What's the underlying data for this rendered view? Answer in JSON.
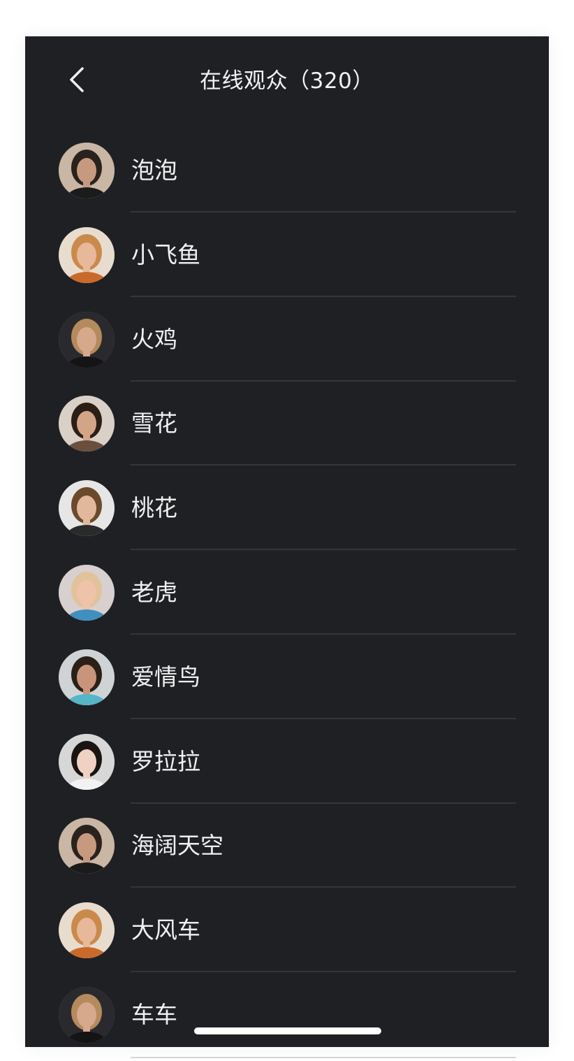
{
  "nav": {
    "title": "在线观众（320）"
  },
  "icons": {
    "back": "chevron-left-icon"
  },
  "colors": {
    "background": "#1f2024",
    "text": "#f0f0f0",
    "divider": "#34363b",
    "indicator": "#ffffff"
  },
  "viewers": [
    {
      "name": "泡泡",
      "avatar": {
        "bg": "#c9b6a4",
        "hair": "#2a221d",
        "skin": "#c79a80",
        "shirt": "#1b1b1b"
      }
    },
    {
      "name": "小飞鱼",
      "avatar": {
        "bg": "#e8dccf",
        "hair": "#c98a4b",
        "skin": "#e8b89a",
        "shirt": "#c96a2a"
      }
    },
    {
      "name": "火鸡",
      "avatar": {
        "bg": "#2a2a2e",
        "hair": "#b58b5e",
        "skin": "#d6a98c",
        "shirt": "#141414"
      }
    },
    {
      "name": "雪花",
      "avatar": {
        "bg": "#d9d0c8",
        "hair": "#2b1e17",
        "skin": "#d3a587",
        "shirt": "#6b4e3d"
      }
    },
    {
      "name": "桃花",
      "avatar": {
        "bg": "#e6e6e6",
        "hair": "#6b4a2b",
        "skin": "#e2b89c",
        "shirt": "#2a2a2a"
      }
    },
    {
      "name": "老虎",
      "avatar": {
        "bg": "#d8cfcf",
        "hair": "#e2c29b",
        "skin": "#efc2aa",
        "shirt": "#3f8fbf"
      }
    },
    {
      "name": "爱情鸟",
      "avatar": {
        "bg": "#cfd3d6",
        "hair": "#2b2018",
        "skin": "#c8957a",
        "shirt": "#54b6c7"
      }
    },
    {
      "name": "罗拉拉",
      "avatar": {
        "bg": "#d7d7d7",
        "hair": "#1a1412",
        "skin": "#efd2c4",
        "shirt": "#f2f2f2"
      }
    },
    {
      "name": "海阔天空",
      "avatar": {
        "bg": "#c9b6a4",
        "hair": "#2a221d",
        "skin": "#c79a80",
        "shirt": "#1b1b1b"
      }
    },
    {
      "name": "大风车",
      "avatar": {
        "bg": "#e8dccf",
        "hair": "#c98a4b",
        "skin": "#e8b89a",
        "shirt": "#c96a2a"
      }
    },
    {
      "name": "车车",
      "avatar": {
        "bg": "#2a2a2e",
        "hair": "#b58b5e",
        "skin": "#d6a98c",
        "shirt": "#141414"
      }
    }
  ]
}
